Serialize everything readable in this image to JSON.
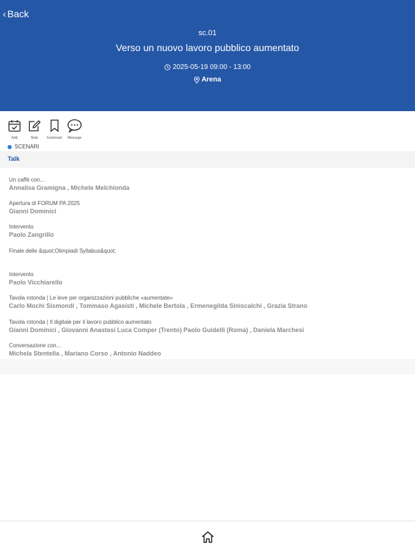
{
  "header": {
    "back_label": "Back",
    "code": "sc.01",
    "title": "Verso un nuovo lavoro pubblico aumentato",
    "datetime": "2025-05-19 09:00 - 13:00",
    "location": "Arena"
  },
  "actions": [
    {
      "label": "Add",
      "icon": "calendar-check-icon"
    },
    {
      "label": "Note",
      "icon": "note-edit-icon"
    },
    {
      "label": "bookmark",
      "icon": "bookmark-icon"
    },
    {
      "label": "Message",
      "icon": "message-bubble-icon"
    }
  ],
  "tag": {
    "label": "SCENARI",
    "color": "#2a7fd4"
  },
  "section": {
    "label": "Talk"
  },
  "talks": [
    {
      "title": "Un caffè con...",
      "speakers": "Annalisa Gramigna , Michele Melchionda"
    },
    {
      "title": "Apertura di FORUM PA 2025",
      "speakers": "Gianni Dominici"
    },
    {
      "title": "Intervento",
      "speakers": "Paolo Zangrillo"
    },
    {
      "title": "Finale delle &quot;Olimpiadi Syllabus&quot;",
      "speakers": ""
    },
    {
      "title": "Intervento",
      "speakers": "Paolo Vicchiarello"
    },
    {
      "title": "Tavola rotonda | Le leve per organizzazioni pubbliche «aumentate»",
      "speakers": "Carlo Mochi Sismondi , Tommaso Agasisti , Michele Bertola , Ermenegilda Siniscalchi , Grazia Strano"
    },
    {
      "title": "Tavola rotonda | Il digitale per il lavoro pubblico aumentato",
      "speakers": "Gianni Dominici , Giovanni Anastasi Luca Comper (Trento) Paolo Guidelli (Roma) , Daniela Marchesi"
    },
    {
      "title": "Conversazione con...",
      "speakers": "Michela Stentella , Mariano Corso , Antonio Naddeo"
    }
  ],
  "footer": {
    "icon": "home-icon"
  },
  "colors": {
    "brand": "#2557a7",
    "speaker": "#8b8b8b"
  }
}
